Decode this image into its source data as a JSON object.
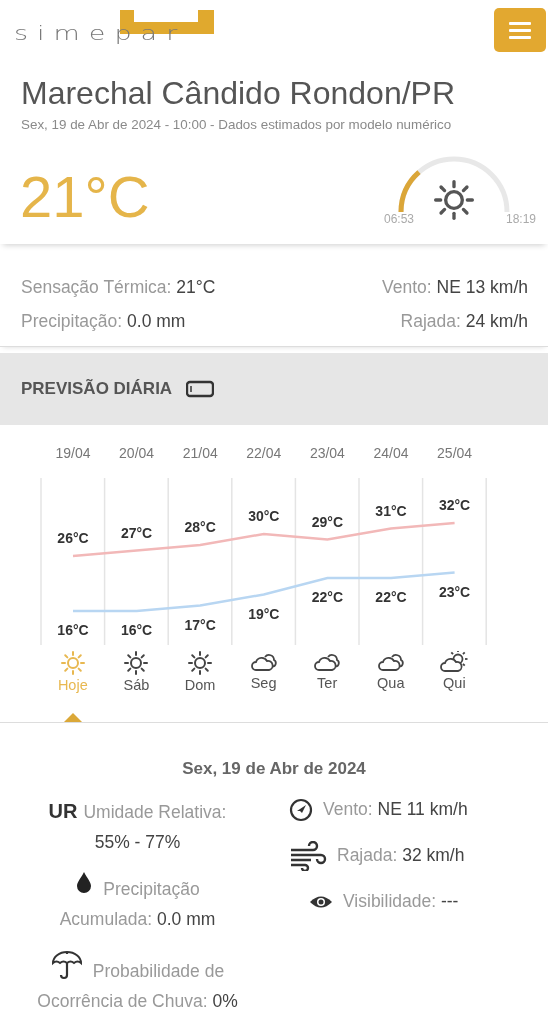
{
  "header": {
    "logo_text": "simepar"
  },
  "location": {
    "title": "Marechal Cândido Rondon/PR",
    "subtitle": "Sex, 19 de Abr de 2024 - 10:00 - Dados estimados por modelo numérico",
    "temperature": "21°C"
  },
  "sun": {
    "sunrise": "06:53",
    "sunset": "18:19"
  },
  "current": [
    {
      "label": "Sensação Térmica:",
      "value": "21°C"
    },
    {
      "label": "Vento:",
      "value": "NE 13 km/h"
    },
    {
      "label": "Precipitação:",
      "value": "0.0 mm"
    },
    {
      "label": "Rajada:",
      "value": "24 km/h"
    }
  ],
  "section": {
    "title": "PREVISÃO DIÁRIA"
  },
  "forecast": {
    "chart_data": {
      "type": "line",
      "categories": [
        "19/04",
        "20/04",
        "21/04",
        "22/04",
        "23/04",
        "24/04",
        "25/04"
      ],
      "data_labels": true,
      "series": [
        {
          "color": "#f2b8b8",
          "values": [
            26,
            27,
            28,
            30,
            29,
            31,
            32
          ],
          "value_labels": [
            "26°C",
            "27°C",
            "28°C",
            "30°C",
            "29°C",
            "31°C",
            "32°C"
          ]
        },
        {
          "color": "#b8d6f2",
          "values": [
            16,
            16,
            17,
            19,
            22,
            22,
            23
          ],
          "value_labels": [
            "16°C",
            "16°C",
            "17°C",
            "19°C",
            "22°C",
            "22°C",
            "23°C"
          ]
        }
      ]
    },
    "days": [
      {
        "label": "Hoje",
        "kind": "sun",
        "selected": true
      },
      {
        "label": "Sáb",
        "kind": "sun",
        "selected": false
      },
      {
        "label": "Dom",
        "kind": "sun",
        "selected": false
      },
      {
        "label": "Seg",
        "kind": "cloud",
        "selected": false
      },
      {
        "label": "Ter",
        "kind": "cloud",
        "selected": false
      },
      {
        "label": "Qua",
        "kind": "cloud",
        "selected": false
      },
      {
        "label": "Qui",
        "kind": "partly_cloudy",
        "selected": false
      }
    ]
  },
  "details": {
    "date": "Sex, 19 de Abr de 2024",
    "left": [
      {
        "kind": "humidity",
        "badge": "UR",
        "label": "Umidade Relativa:",
        "value": "55% - 77%"
      },
      {
        "kind": "precipitation",
        "label": "Precipitação",
        "label_2": "Acumulada:",
        "value": "0.0 mm"
      },
      {
        "kind": "rain_probability",
        "label": "Probabilidade de",
        "label_2": "Ocorrência de Chuva:",
        "value": "0%"
      }
    ],
    "right": [
      {
        "kind": "wind",
        "label": "Vento:",
        "value": "NE 11 km/h"
      },
      {
        "kind": "gust",
        "label": "Rajada:",
        "value": "32 km/h"
      },
      {
        "kind": "visibility",
        "label": "Visibilidade:",
        "value": "---"
      }
    ]
  }
}
